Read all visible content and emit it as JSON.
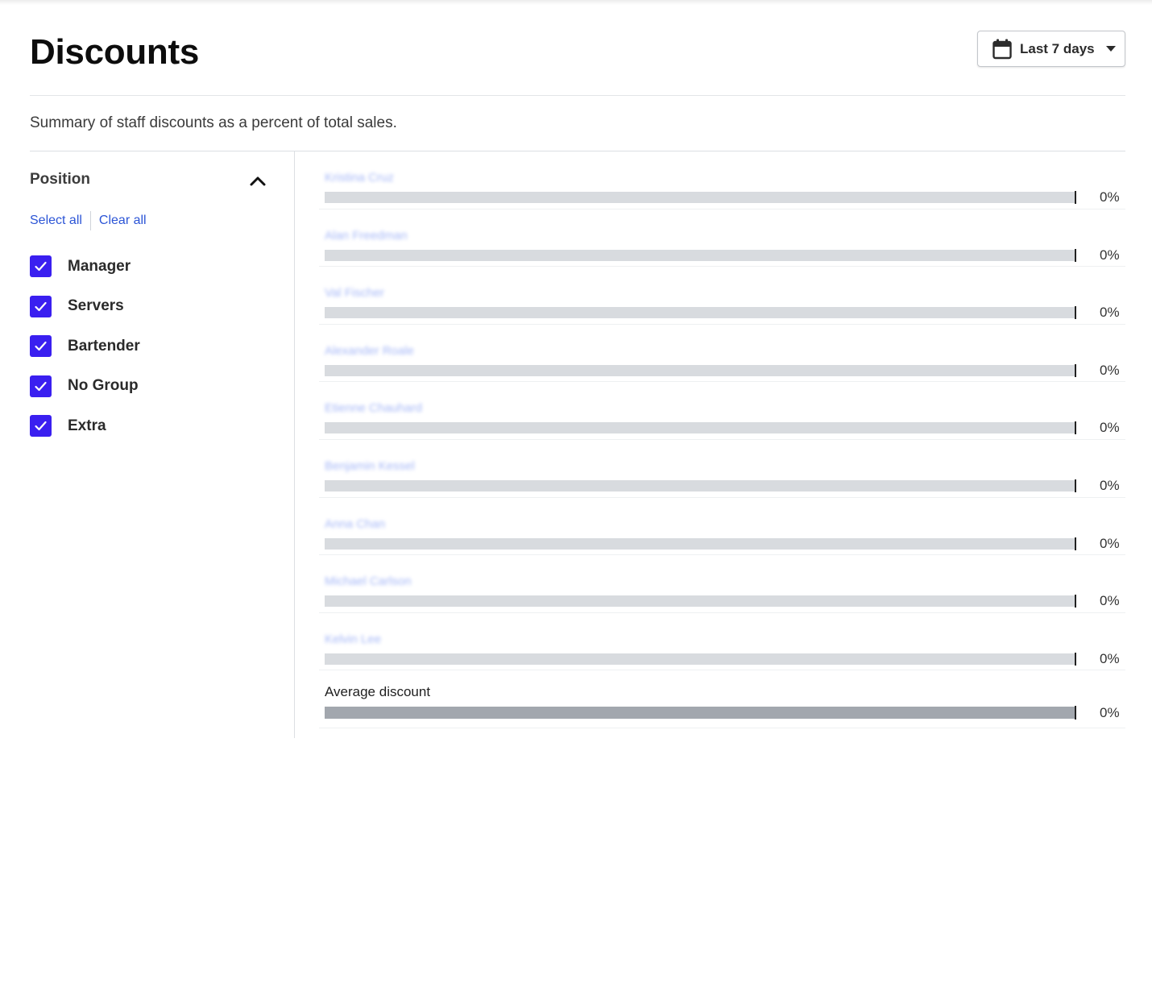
{
  "page": {
    "title": "Discounts",
    "subtitle": "Summary of staff discounts as a percent of total sales."
  },
  "date_filter": {
    "label": "Last 7 days",
    "icon": "calendar-icon"
  },
  "filter": {
    "title": "Position",
    "select_all": "Select all",
    "clear_all": "Clear all",
    "options": [
      {
        "label": "Manager",
        "checked": true
      },
      {
        "label": "Servers",
        "checked": true
      },
      {
        "label": "Bartender",
        "checked": true
      },
      {
        "label": "No Group",
        "checked": true
      },
      {
        "label": "Extra",
        "checked": true
      }
    ]
  },
  "colors": {
    "accent": "#3a1ff0",
    "link": "#2c55d6",
    "bar_track": "#d8dbdf",
    "avg_bar": "#a2a7ae"
  },
  "chart_data": {
    "type": "bar",
    "orientation": "horizontal",
    "categories": [
      "Kristina Cruz",
      "Alan Freedman",
      "Val Fischer",
      "Alexander Roale",
      "Etienne Chauhard",
      "Benjamin Kessel",
      "Anna Chan",
      "Michael Carlson",
      "Kelvin Lee",
      "Average discount"
    ],
    "values": [
      0,
      0,
      0,
      0,
      0,
      0,
      0,
      0,
      0,
      0
    ],
    "value_labels": [
      "0%",
      "0%",
      "0%",
      "0%",
      "0%",
      "0%",
      "0%",
      "0%",
      "0%",
      "0%"
    ],
    "xlim": [
      0,
      100
    ],
    "unit": "%"
  }
}
